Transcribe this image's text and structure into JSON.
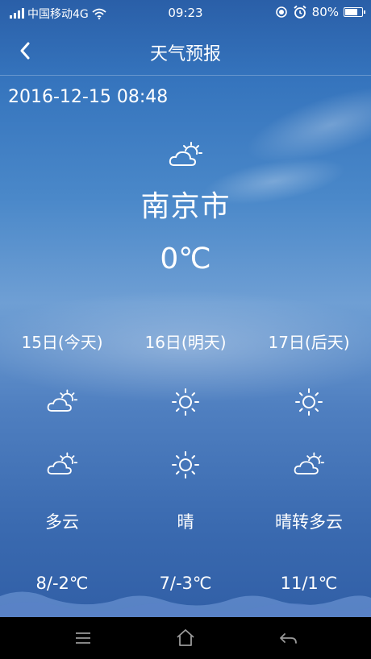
{
  "status_bar": {
    "carrier": "中国移动4G",
    "time": "09:23",
    "battery": "80%",
    "battery_level": 0.8
  },
  "title_bar": {
    "title": "天气预报"
  },
  "datetime": "2016-12-15 08:48",
  "current": {
    "icon": "partly-cloudy-icon",
    "city": "南京市",
    "temperature": "0℃"
  },
  "forecast": [
    {
      "day": "15日(今天)",
      "icon_day": "partly-cloudy-icon",
      "icon_night": "partly-cloudy-icon",
      "description": "多云",
      "range": "8/-2℃"
    },
    {
      "day": "16日(明天)",
      "icon_day": "sun-icon",
      "icon_night": "sun-icon",
      "description": "晴",
      "range": "7/-3℃"
    },
    {
      "day": "17日(后天)",
      "icon_day": "sun-icon",
      "icon_night": "partly-cloudy-icon",
      "description": "晴转多云",
      "range": "11/1℃"
    }
  ],
  "nav_bar": {
    "menu_icon": "menu-icon",
    "home_icon": "home-icon",
    "back_icon": "back-icon"
  }
}
